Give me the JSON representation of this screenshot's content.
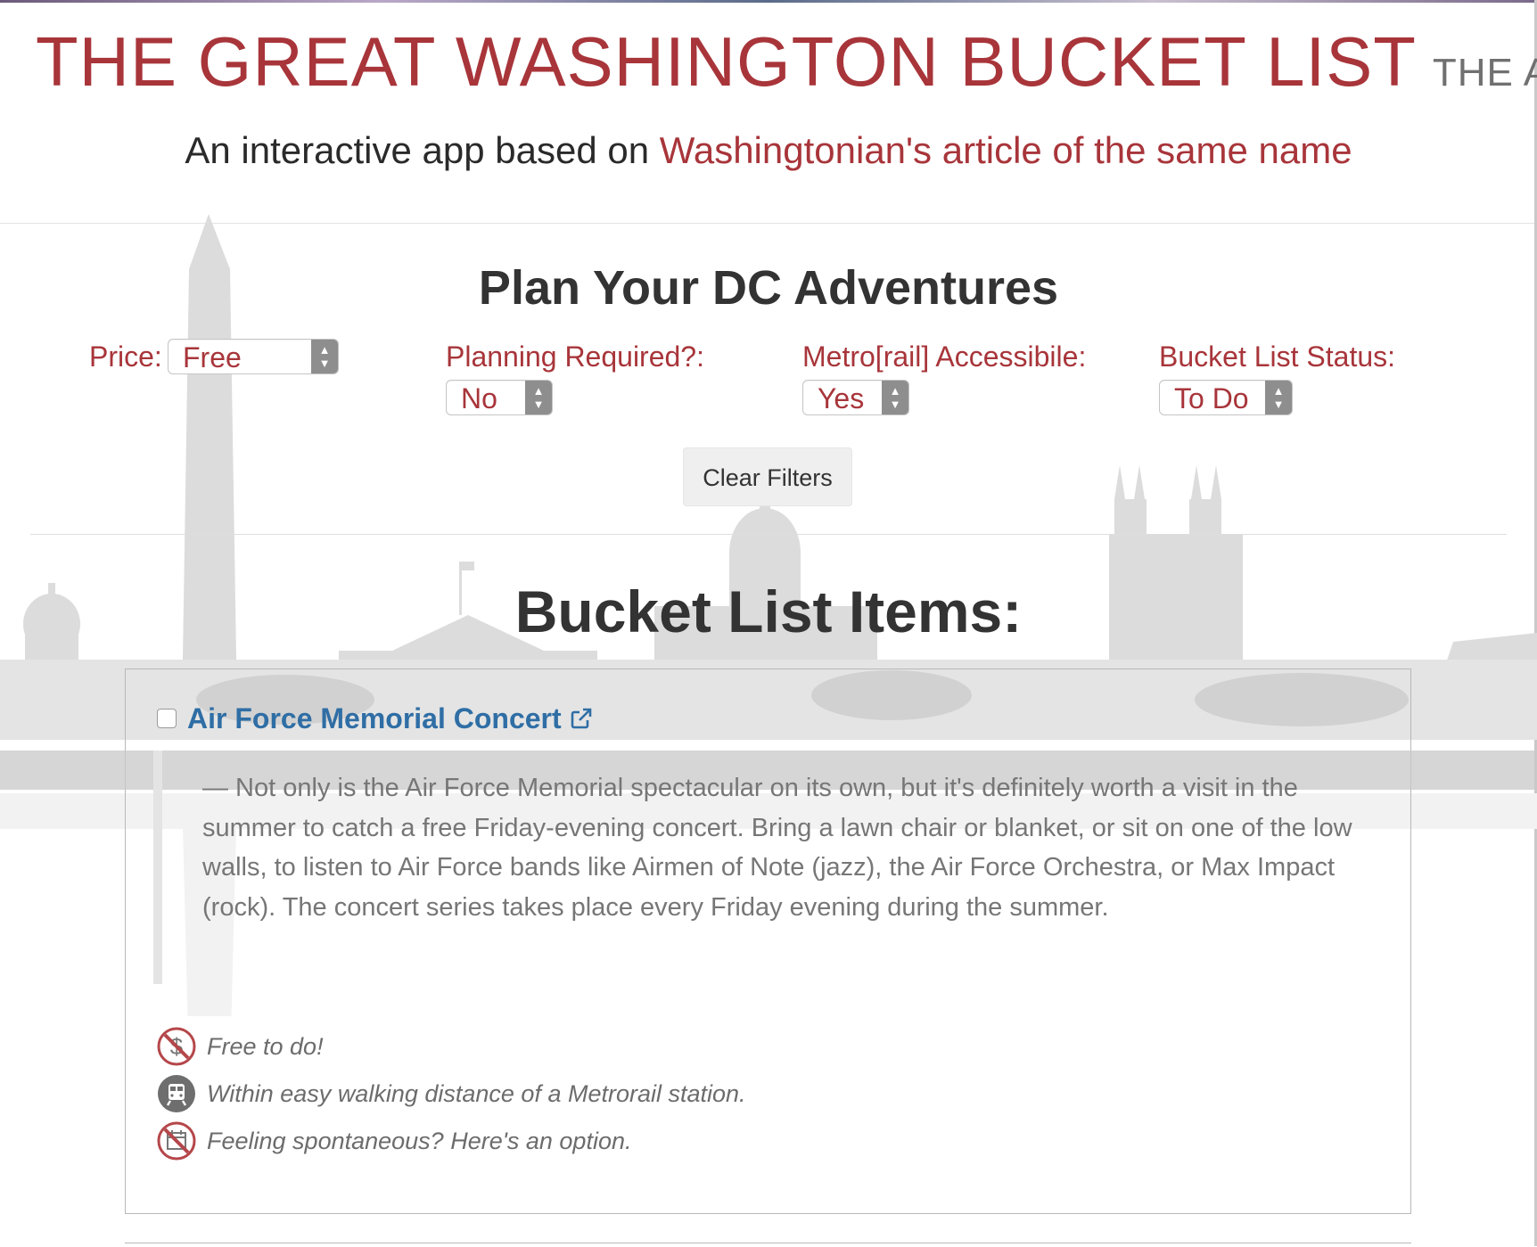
{
  "header": {
    "title": "THE GREAT WASHINGTON BUCKET LIST",
    "title_suffix": "THE APP",
    "tagline_prefix": "An interactive app based on ",
    "tagline_link": "Washingtonian's article of the same name"
  },
  "filters": {
    "heading": "Plan Your DC Adventures",
    "price": {
      "label": "Price:",
      "value": "Free"
    },
    "planning": {
      "label": "Planning Required?:",
      "value": "No"
    },
    "metro": {
      "label": "Metro[rail] Accessibile:",
      "value": "Yes"
    },
    "status": {
      "label": "Bucket List Status:",
      "value": "To Do"
    },
    "clear_label": "Clear Filters"
  },
  "items_heading": "Bucket List Items:",
  "items": [
    {
      "title": "Air Force Memorial Concert",
      "description": "— Not only is the Air Force Memorial spectacular on its own, but it's definitely worth a visit in the summer to catch a free Friday-evening concert. Bring a lawn chair or blanket, or sit on one of the low walls, to listen to Air Force bands like Airmen of Note (jazz), the Air Force Orchestra, or Max Impact (rock). The concert series takes place every Friday evening during the summer.",
      "checked": false,
      "meta": [
        {
          "icon": "free-dollar-icon",
          "text": "Free to do!"
        },
        {
          "icon": "metro-train-icon",
          "text": "Within easy walking distance of a Metrorail station."
        },
        {
          "icon": "no-calendar-icon",
          "text": "Feeling spontaneous? Here's an option."
        }
      ]
    }
  ],
  "colors": {
    "brand_red": "#a8353a",
    "link_blue": "#2f6ea5",
    "skyline_gray": "#d9d9d9"
  }
}
